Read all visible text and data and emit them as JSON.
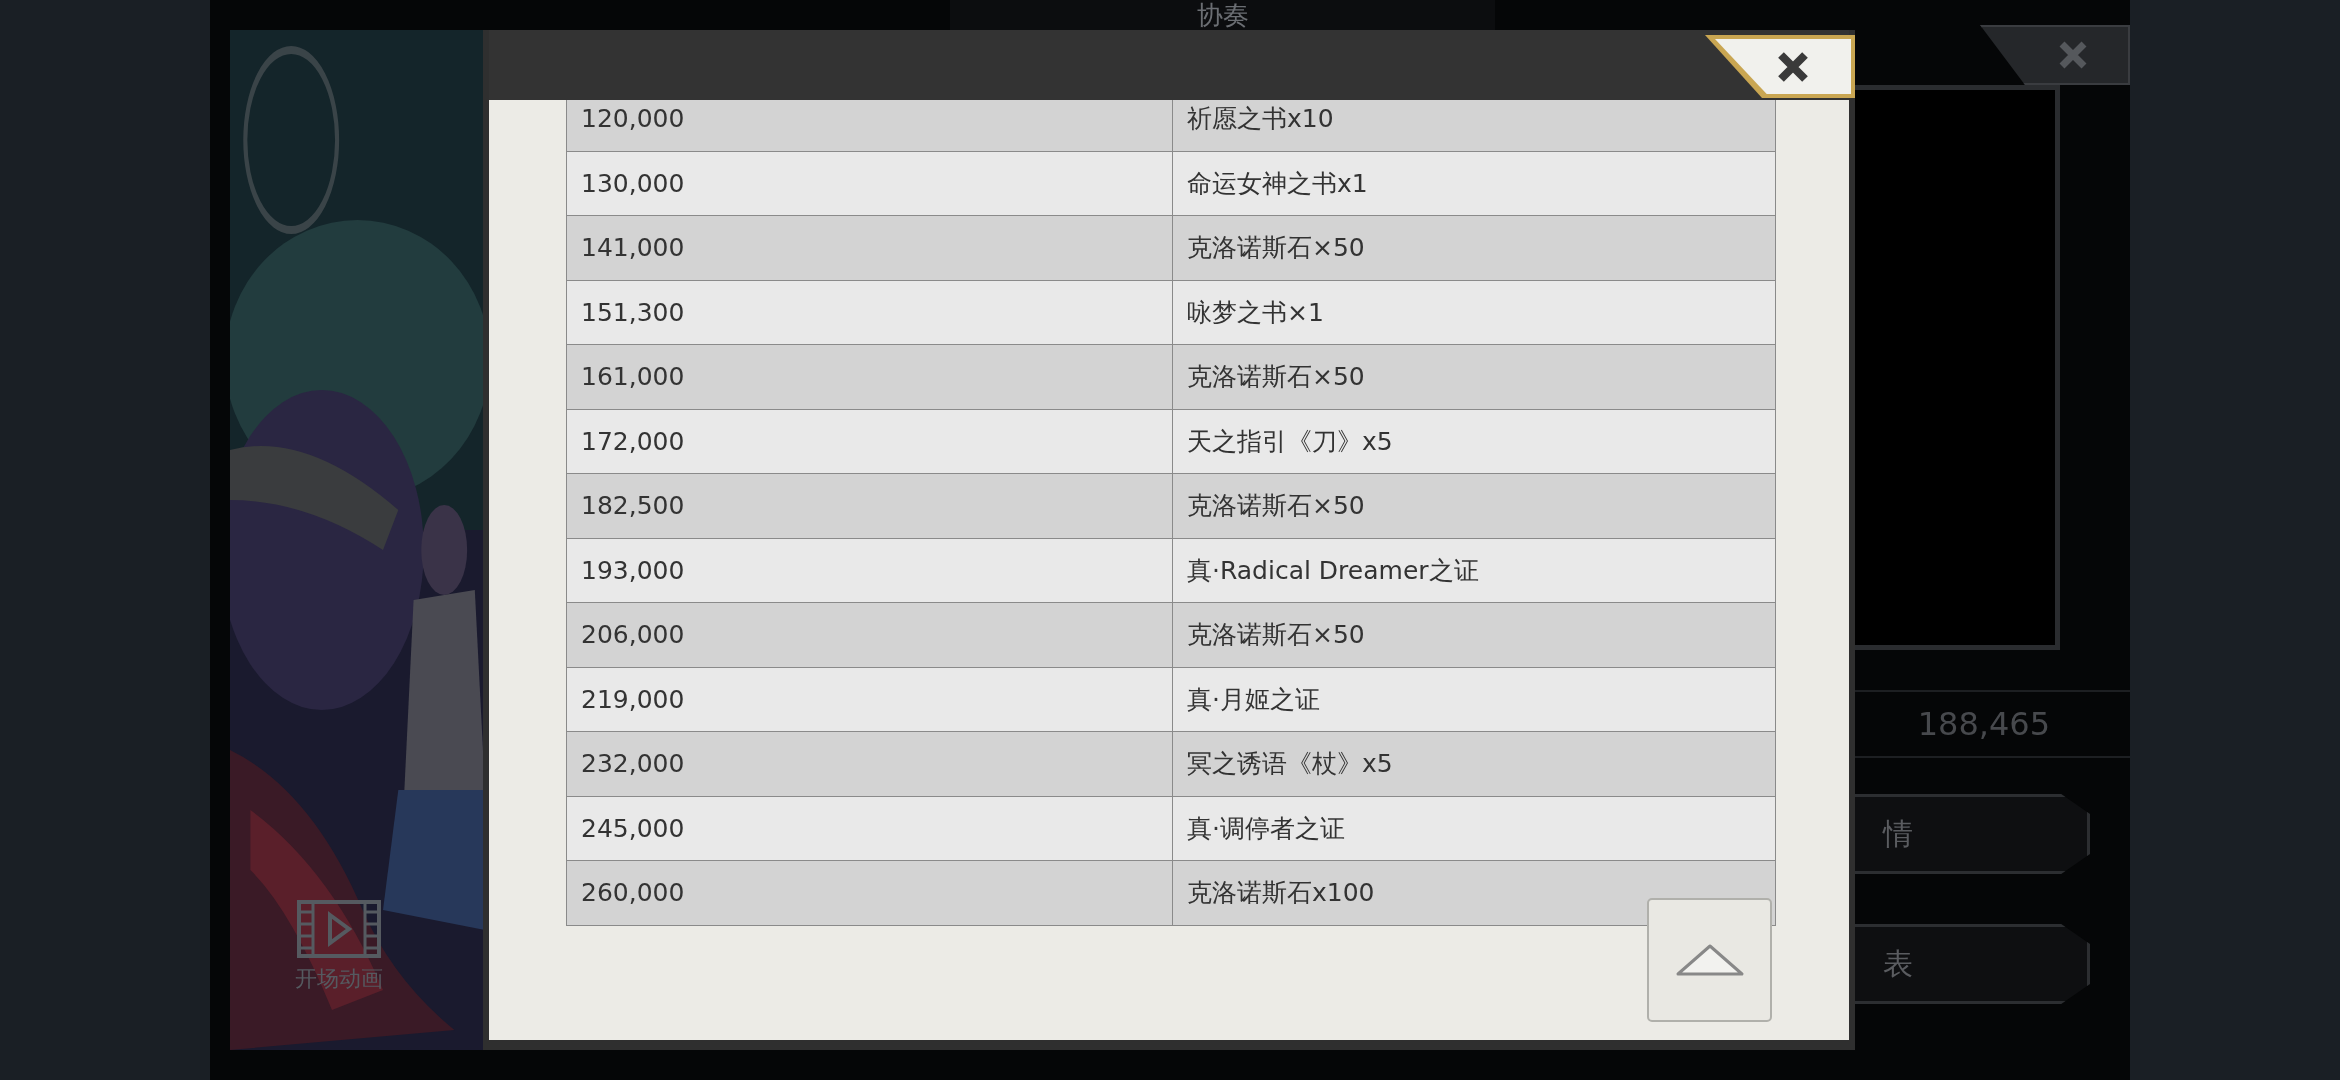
{
  "background": {
    "title": "协奏",
    "video_button": {
      "label": "开场动画"
    },
    "score": "188,465",
    "buttons": [
      {
        "label": "情"
      },
      {
        "label": "表"
      }
    ]
  },
  "dialog": {
    "rows": [
      {
        "points": "120,000",
        "reward": "祈愿之书x10"
      },
      {
        "points": "130,000",
        "reward": "命运女神之书x1"
      },
      {
        "points": "141,000",
        "reward": "克洛诺斯石×50"
      },
      {
        "points": "151,300",
        "reward": "咏梦之书×1"
      },
      {
        "points": "161,000",
        "reward": "克洛诺斯石×50"
      },
      {
        "points": "172,000",
        "reward": "天之指引《刀》x5"
      },
      {
        "points": "182,500",
        "reward": "克洛诺斯石×50"
      },
      {
        "points": "193,000",
        "reward": "真·Radical Dreamer之证"
      },
      {
        "points": "206,000",
        "reward": "克洛诺斯石×50"
      },
      {
        "points": "219,000",
        "reward": "真·月姬之证"
      },
      {
        "points": "232,000",
        "reward": "冥之诱语《杖》x5"
      },
      {
        "points": "245,000",
        "reward": "真·调停者之证"
      },
      {
        "points": "260,000",
        "reward": "克洛诺斯石x100"
      }
    ]
  }
}
